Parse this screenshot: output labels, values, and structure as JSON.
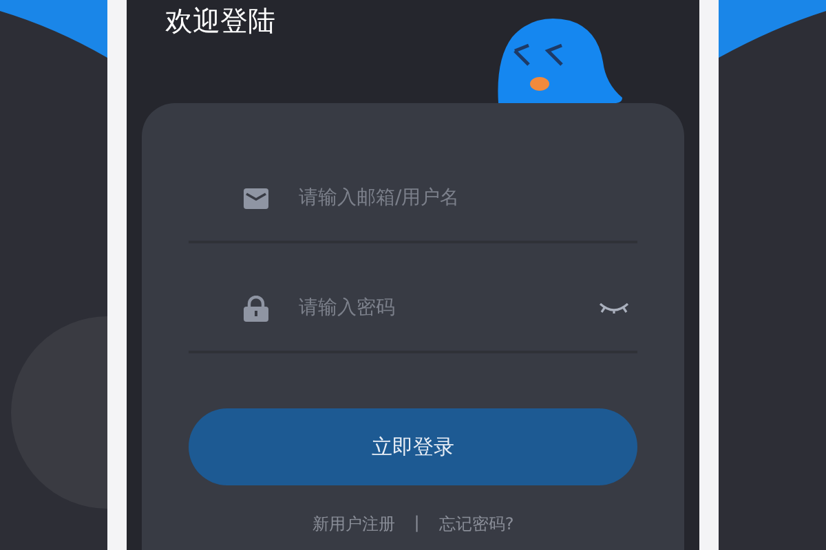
{
  "title": "欢迎登陆",
  "fields": [
    {
      "kind": "email",
      "placeholder": "请输入邮箱/用户名"
    },
    {
      "kind": "password",
      "placeholder": "请输入密码"
    }
  ],
  "login_button": "立即登录",
  "links": [
    "新用户注册",
    "|",
    "忘记密码?"
  ]
}
